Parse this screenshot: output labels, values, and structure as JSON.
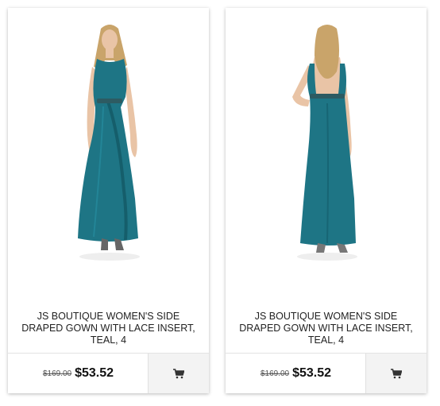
{
  "products": [
    {
      "view": "front",
      "title": "JS BOUTIQUE WOMEN'S SIDE DRAPED GOWN WITH LACE INSERT, TEAL, 4",
      "old_price": "$169.00",
      "new_price": "$53.52",
      "cart_icon": "shopping-cart-icon"
    },
    {
      "view": "back",
      "title": "JS BOUTIQUE WOMEN'S SIDE DRAPED GOWN WITH LACE INSERT, TEAL, 4",
      "old_price": "$169.00",
      "new_price": "$53.52",
      "cart_icon": "shopping-cart-icon"
    }
  ],
  "colors": {
    "dress_teal": "#1e7585",
    "hair_blonde": "#c9a46a",
    "skin": "#e9c4a6",
    "card_border": "#e3e3e3",
    "cart_bg": "#f3f3f3"
  }
}
